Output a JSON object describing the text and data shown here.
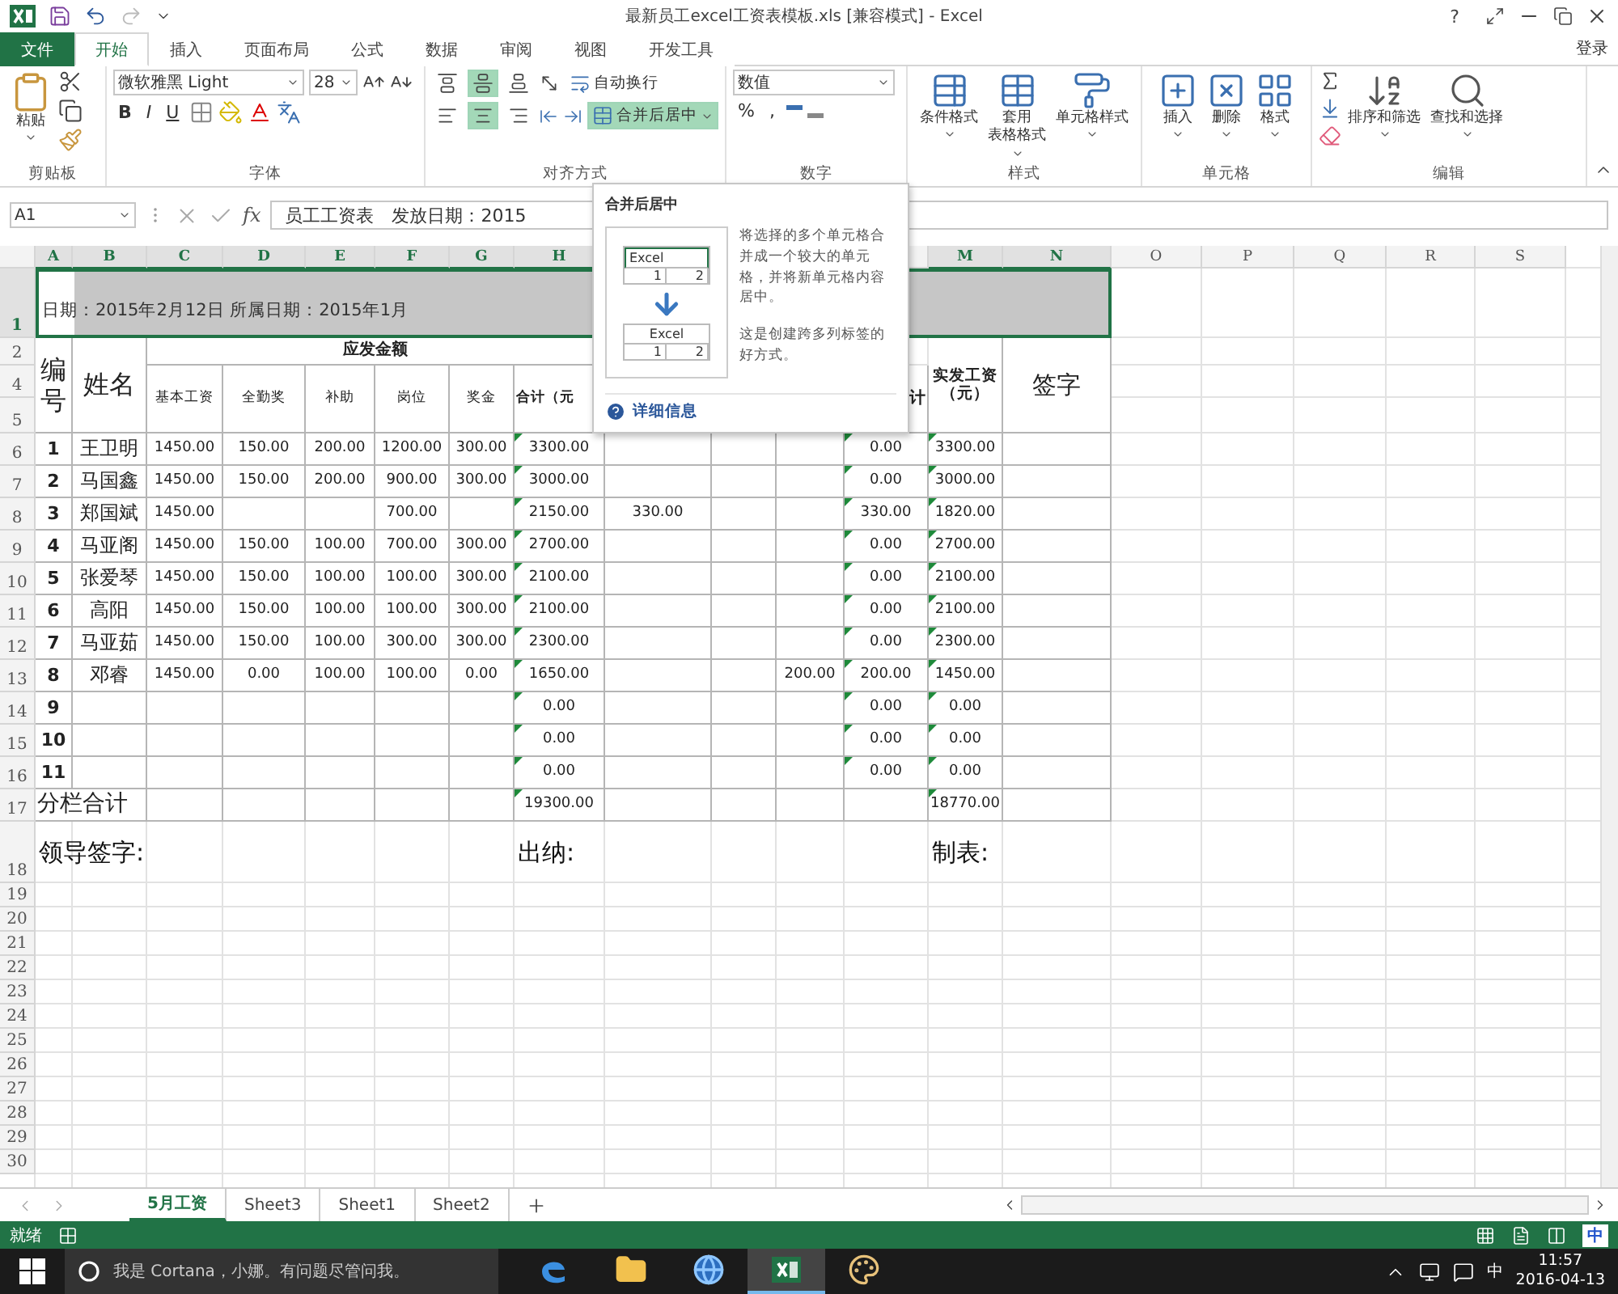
{
  "window": {
    "title": "最新员工excel工资表模板.xls  [兼容模式] - Excel",
    "help": "?"
  },
  "ribbon_tabs": [
    {
      "label": "文件",
      "kind": "file",
      "selected": false
    },
    {
      "label": "开始",
      "kind": "tab",
      "selected": true
    },
    {
      "label": "插入",
      "kind": "tab",
      "selected": false
    },
    {
      "label": "页面布局",
      "kind": "tab",
      "selected": false
    },
    {
      "label": "公式",
      "kind": "tab",
      "selected": false
    },
    {
      "label": "数据",
      "kind": "tab",
      "selected": false
    },
    {
      "label": "审阅",
      "kind": "tab",
      "selected": false
    },
    {
      "label": "视图",
      "kind": "tab",
      "selected": false
    },
    {
      "label": "开发工具",
      "kind": "tab",
      "selected": false
    }
  ],
  "account": "登录",
  "ribbon": {
    "clipboard": {
      "label": "剪贴板",
      "paste": "粘贴"
    },
    "font": {
      "label": "字体",
      "family": "微软雅黑 Light",
      "size": "28",
      "styles": [
        "B",
        "I",
        "U"
      ]
    },
    "alignment": {
      "label": "对齐方式",
      "vertical": [
        {
          "selected": false
        },
        {
          "selected": true
        },
        {
          "selected": false
        }
      ],
      "horizontal": [
        {
          "selected": false
        },
        {
          "selected": true
        },
        {
          "selected": false
        }
      ],
      "wrap": {
        "label": "自动换行",
        "selected": false
      },
      "merge": {
        "label": "合并后居中",
        "selected": true
      }
    },
    "number": {
      "label": "数字",
      "format": "数值",
      "symbols": [
        "%",
        ","
      ]
    },
    "styles": {
      "label": "样式",
      "buttons": [
        {
          "lines": [
            "条件格式"
          ]
        },
        {
          "lines": [
            "套用",
            "表格格式"
          ]
        },
        {
          "lines": [
            "单元格样式"
          ]
        }
      ]
    },
    "cells": {
      "label": "单元格",
      "buttons": [
        "插入",
        "删除",
        "格式"
      ]
    },
    "editing": {
      "label": "编辑",
      "buttons": [
        "排序和筛选",
        "查找和选择"
      ]
    }
  },
  "formula_bar": {
    "name_box": "A1",
    "fx": "fx",
    "formula": "员工工资表　发放日期：2015"
  },
  "sheet": {
    "column_headers": [
      "A",
      "B",
      "C",
      "D",
      "E",
      "F",
      "G",
      "H",
      "M",
      "N",
      "O",
      "P",
      "Q",
      "R",
      "S"
    ],
    "row_numbers": [
      "1",
      "2",
      "4",
      "5",
      "6",
      "7",
      "8",
      "9",
      "10",
      "11",
      "12",
      "13",
      "14",
      "15",
      "16",
      "17",
      "18",
      "19",
      "20",
      "21",
      "22",
      "23",
      "24",
      "25",
      "26",
      "27",
      "28",
      "29",
      "30"
    ],
    "banner": {
      "text": "日期：2015年2月12日 所属日期：2015年1月",
      "selected": true
    },
    "head": {
      "id": "编号",
      "name": "姓名",
      "group": "应发金额",
      "columns": [
        "基本工资",
        "全勤奖",
        "补助",
        "岗位",
        "奖金",
        "合计（元"
      ],
      "deduction_total": "计",
      "net": "实发工资（元）",
      "sign": "签字"
    },
    "rows": [
      {
        "cells": {
          "A": "1",
          "B": "王卫明",
          "C": "1450.00",
          "D": "150.00",
          "E": "200.00",
          "F": "1200.00",
          "G": "300.00",
          "H": "3300.00",
          "L": "0.00",
          "M": "3300.00"
        },
        "flagged": {
          "H": true,
          "L": true,
          "M": true
        }
      },
      {
        "cells": {
          "A": "2",
          "B": "马国鑫",
          "C": "1450.00",
          "D": "150.00",
          "E": "200.00",
          "F": "900.00",
          "G": "300.00",
          "H": "3000.00",
          "L": "0.00",
          "M": "3000.00"
        },
        "flagged": {
          "H": true,
          "L": true,
          "M": true
        }
      },
      {
        "cells": {
          "A": "3",
          "B": "郑国斌",
          "C": "1450.00",
          "F": "700.00",
          "H": "2150.00",
          "I": "330.00",
          "L": "330.00",
          "M": "1820.00"
        },
        "flagged": {
          "H": true,
          "L": true,
          "M": true
        }
      },
      {
        "cells": {
          "A": "4",
          "B": "马亚阁",
          "C": "1450.00",
          "D": "150.00",
          "E": "100.00",
          "F": "700.00",
          "G": "300.00",
          "H": "2700.00",
          "L": "0.00",
          "M": "2700.00"
        },
        "flagged": {
          "H": true,
          "L": true,
          "M": true
        }
      },
      {
        "cells": {
          "A": "5",
          "B": "张爱琴",
          "C": "1450.00",
          "D": "150.00",
          "E": "100.00",
          "F": "100.00",
          "G": "300.00",
          "H": "2100.00",
          "L": "0.00",
          "M": "2100.00"
        },
        "flagged": {
          "H": true,
          "L": true,
          "M": true
        }
      },
      {
        "cells": {
          "A": "6",
          "B": "高阳",
          "C": "1450.00",
          "D": "150.00",
          "E": "100.00",
          "F": "100.00",
          "G": "300.00",
          "H": "2100.00",
          "L": "0.00",
          "M": "2100.00"
        },
        "flagged": {
          "H": true,
          "L": true,
          "M": true
        }
      },
      {
        "cells": {
          "A": "7",
          "B": "马亚茹",
          "C": "1450.00",
          "D": "150.00",
          "E": "100.00",
          "F": "300.00",
          "G": "300.00",
          "H": "2300.00",
          "L": "0.00",
          "M": "2300.00"
        },
        "flagged": {
          "H": true,
          "L": true,
          "M": true
        }
      },
      {
        "cells": {
          "A": "8",
          "B": "邓睿",
          "C": "1450.00",
          "D": "0.00",
          "E": "100.00",
          "F": "100.00",
          "G": "0.00",
          "H": "1650.00",
          "K": "200.00",
          "L": "200.00",
          "M": "1450.00"
        },
        "flagged": {
          "H": true,
          "L": true,
          "M": true
        }
      },
      {
        "cells": {
          "A": "9",
          "H": "0.00",
          "L": "0.00",
          "M": "0.00"
        },
        "flagged": {
          "H": true,
          "L": true,
          "M": true
        }
      },
      {
        "cells": {
          "A": "10",
          "H": "0.00",
          "L": "0.00",
          "M": "0.00"
        },
        "flagged": {
          "H": true,
          "L": true,
          "M": true
        }
      },
      {
        "cells": {
          "A": "11",
          "H": "0.00",
          "L": "0.00",
          "M": "0.00"
        },
        "flagged": {
          "H": true,
          "L": true,
          "M": true
        }
      }
    ],
    "total": {
      "label": "分栏合计",
      "cells": {
        "H": "19300.00",
        "M": "18770.00"
      },
      "flagged": {
        "H": true,
        "M": true
      }
    },
    "signatures": [
      "领导签字:",
      "出纳:",
      "制表:"
    ]
  },
  "tooltip": {
    "title": "合并后居中",
    "before": {
      "header": "Excel",
      "cells": [
        "1",
        "2"
      ]
    },
    "after": {
      "header": "Excel",
      "cells": [
        "1",
        "2"
      ]
    },
    "paragraphs": [
      "将选择的多个单元格合并成一个较大的单元格，并将新单元格内容居中。",
      "这是创建跨多列标签的好方式。"
    ],
    "link": "详细信息"
  },
  "sheet_tabs": [
    {
      "label": "5月工资",
      "selected": true
    },
    {
      "label": "Sheet3",
      "selected": false
    },
    {
      "label": "Sheet1",
      "selected": false
    },
    {
      "label": "Sheet2",
      "selected": false
    }
  ],
  "status_bar": {
    "text": "就绪",
    "ime": "中"
  },
  "taskbar": {
    "search_placeholder": "我是 Cortana，小娜。有问题尽管问我。",
    "apps": [
      {
        "kind": "edge",
        "active": false
      },
      {
        "kind": "folder",
        "active": false
      },
      {
        "kind": "globe",
        "active": false
      },
      {
        "kind": "excel",
        "active": true
      },
      {
        "kind": "paint",
        "active": false
      }
    ],
    "ime": "中",
    "time": "11:57",
    "date": "2016-04-13"
  }
}
